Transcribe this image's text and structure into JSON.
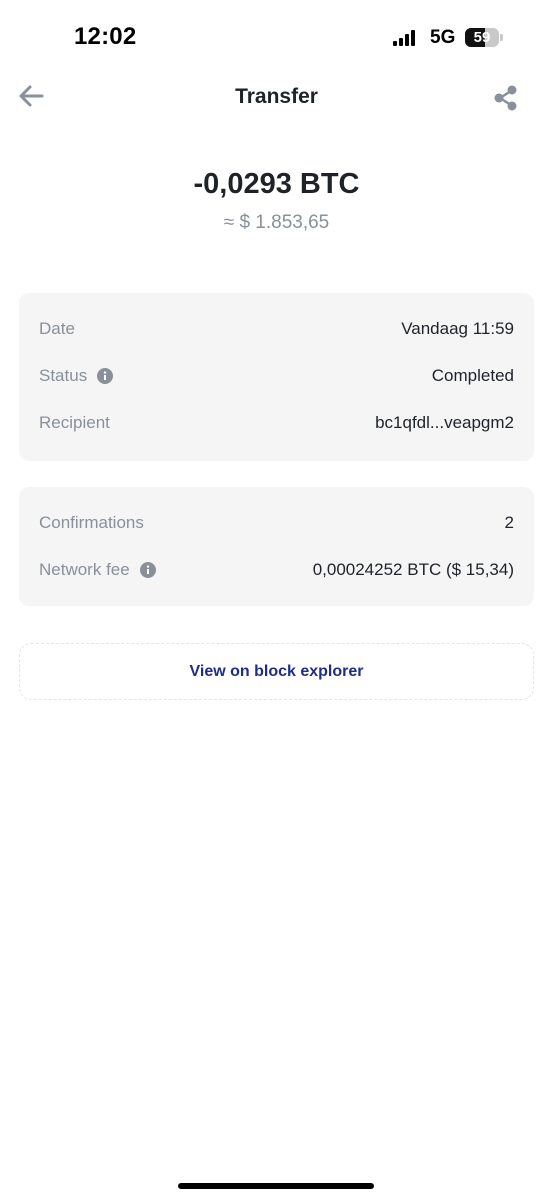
{
  "status_bar": {
    "time": "12:02",
    "network": "5G",
    "battery_level": "59",
    "battery_fraction": 0.59
  },
  "nav": {
    "title": "Transfer",
    "back_icon": "arrow-left-icon",
    "share_icon": "share-icon"
  },
  "amount": {
    "crypto": "-0,0293 BTC",
    "fiat": "≈ $ 1.853,65"
  },
  "details": [
    {
      "label": "Date",
      "value": "Vandaag 11:59",
      "info": false
    },
    {
      "label": "Status",
      "value": "Completed",
      "info": true
    },
    {
      "label": "Recipient",
      "value": "bc1qfdl...veapgm2",
      "info": false
    }
  ],
  "fees": [
    {
      "label": "Confirmations",
      "value": "2",
      "info": false
    },
    {
      "label": "Network fee",
      "value": "0,00024252 BTC ($ 15,34)",
      "info": true
    }
  ],
  "explorer": {
    "label": "View on block explorer"
  },
  "colors": {
    "text_primary": "#1e2329",
    "text_secondary": "#8a909a",
    "card_bg": "#f5f5f6",
    "link": "#1e2d8c"
  }
}
